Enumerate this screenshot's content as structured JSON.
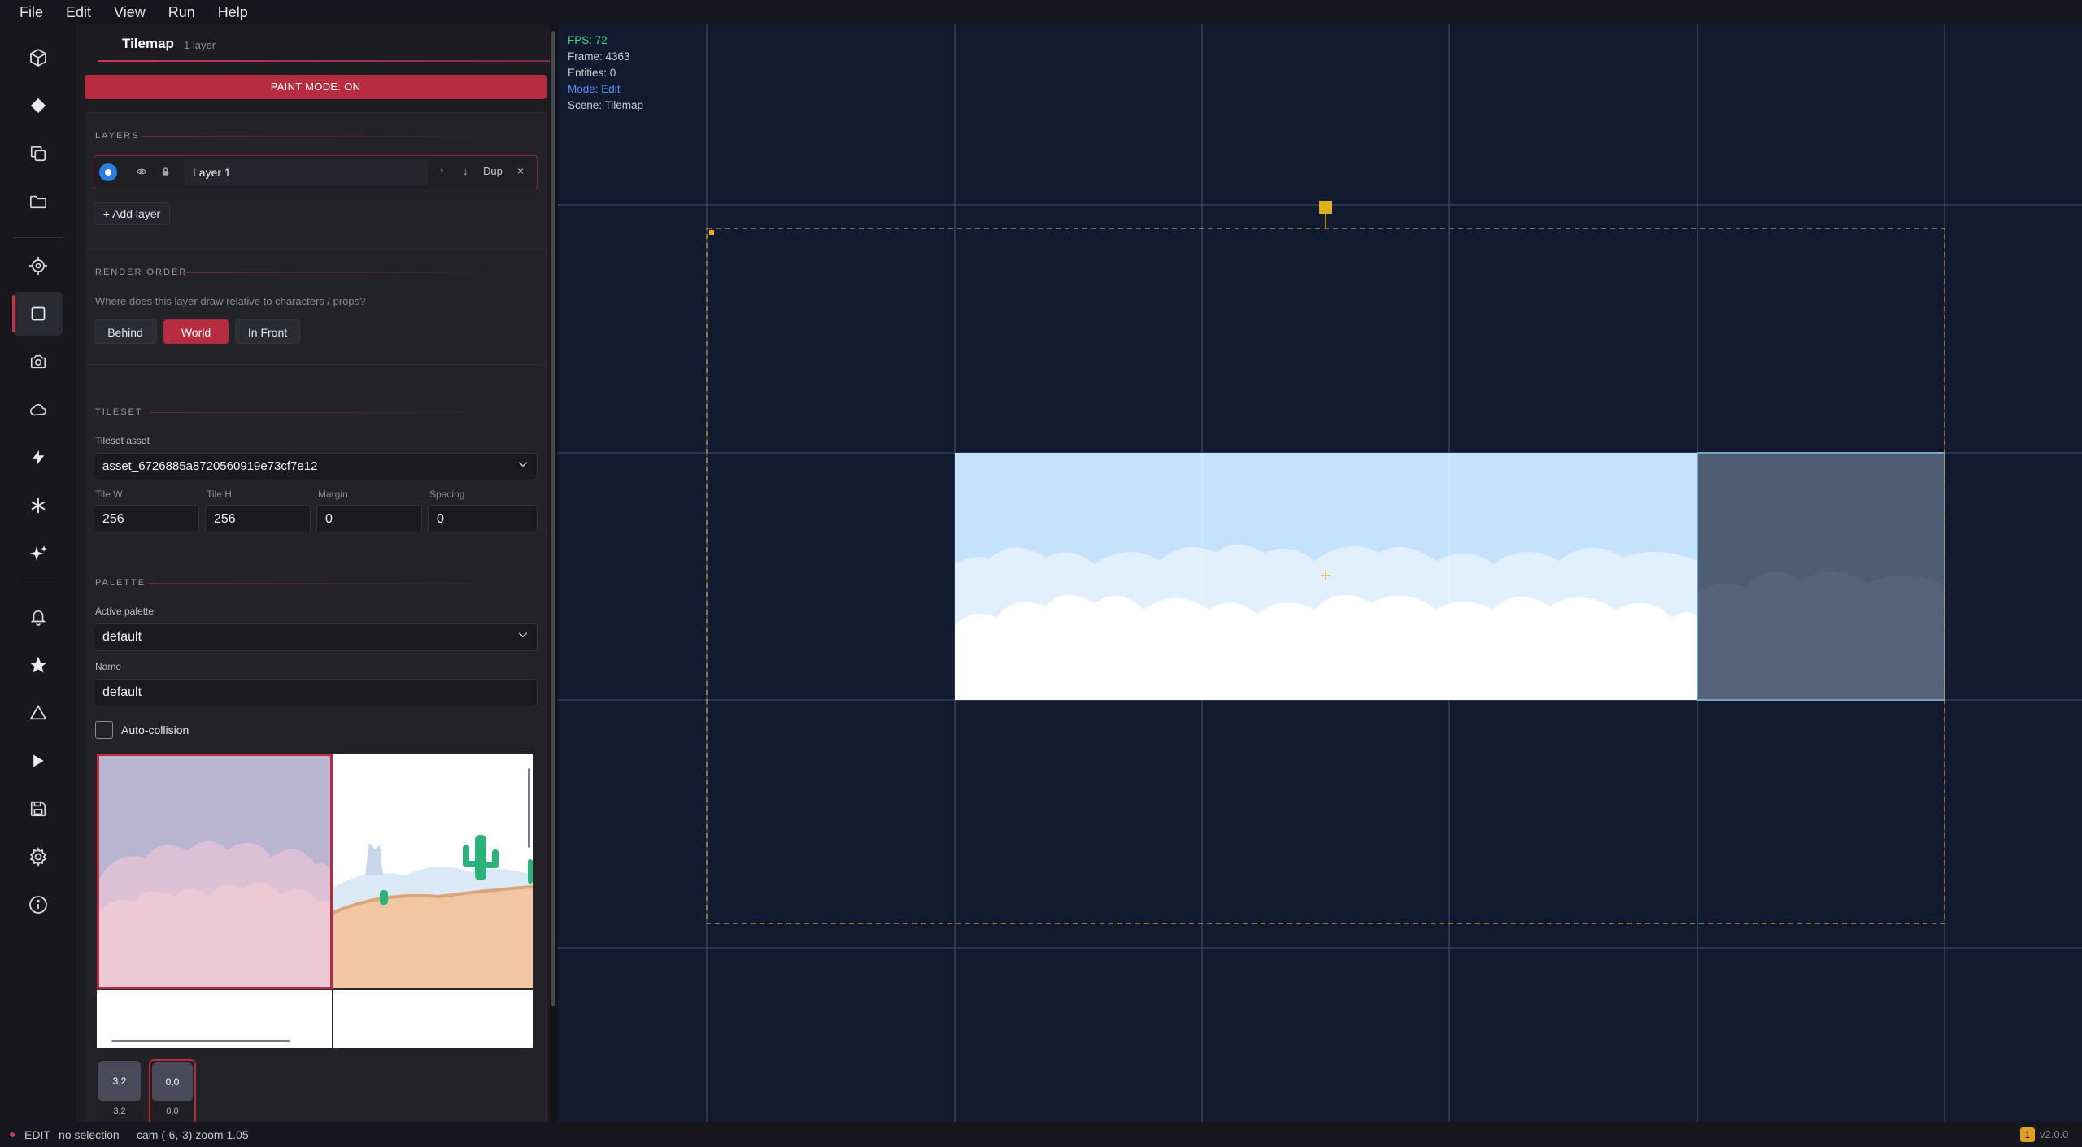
{
  "menu": [
    "File",
    "Edit",
    "View",
    "Run",
    "Help"
  ],
  "rail_icons": [
    "cube-icon",
    "diamond-icon",
    "copy-icon",
    "folder-icon",
    "crosshair-icon",
    "square-icon",
    "camera-icon",
    "cloud-icon",
    "lightning-icon",
    "asterisk-icon",
    "sparkle-icon",
    "bell-icon",
    "star-icon",
    "triangle-icon",
    "play-icon",
    "save-icon",
    "gear-icon",
    "info-icon"
  ],
  "panel": {
    "title": "Tilemap",
    "layer_count": "1 layer",
    "paint_mode": "PAINT MODE: ON",
    "layers": {
      "section": "LAYERS",
      "layer_name": "Layer 1",
      "dup": "Dup",
      "close": "×",
      "up": "↑",
      "down": "↓",
      "add": "+ Add layer"
    },
    "render_order": {
      "section": "RENDER ORDER",
      "question": "Where does this layer draw relative to characters / props?",
      "options": [
        "Behind",
        "World",
        "In Front"
      ],
      "selected": "World"
    },
    "tileset": {
      "section": "TILESET",
      "asset_label": "Tileset asset",
      "asset_value": "asset_6726885a8720560919e73cf7e12",
      "tile_w_label": "Tile W",
      "tile_h_label": "Tile H",
      "margin_label": "Margin",
      "spacing_label": "Spacing",
      "tile_w": "256",
      "tile_h": "256",
      "margin": "0",
      "spacing": "0"
    },
    "palette": {
      "section": "PALETTE",
      "active_label": "Active palette",
      "active_value": "default",
      "name_label": "Name",
      "name_value": "default",
      "auto_collision": "Auto-collision",
      "swatches": [
        {
          "chip": "3,2",
          "caption": "3,2"
        },
        {
          "chip": "0,0",
          "caption": "0,0"
        }
      ]
    }
  },
  "overlay": {
    "fps": "FPS: 72",
    "frame": "Frame: 4363",
    "entities": "Entities: 0",
    "mode": "Mode: Edit",
    "scene": "Scene: Tilemap"
  },
  "status": {
    "mode": "EDIT",
    "selection": "no selection",
    "cam": "cam (-6,-3) zoom 1.05",
    "badge": "1",
    "version": "v2.0.0"
  },
  "colors": {
    "accent": "#b72c41",
    "canvas_bg": "#111a2e",
    "fps_green": "#3ddc84",
    "mode_blue": "#5b8cff",
    "marker_yellow": "#e0b020"
  }
}
